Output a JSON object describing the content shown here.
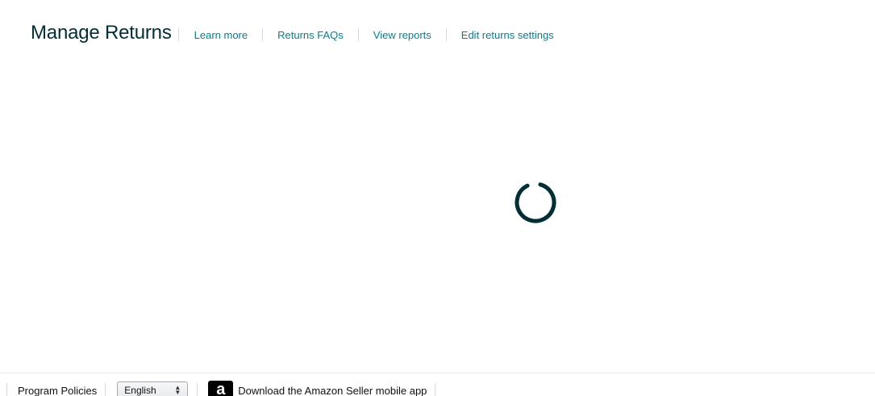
{
  "header": {
    "title": "Manage Returns",
    "links": [
      {
        "label": "Learn more"
      },
      {
        "label": "Returns FAQs"
      },
      {
        "label": "View reports"
      },
      {
        "label": "Edit returns settings"
      }
    ]
  },
  "loading": {
    "icon": "loading-spinner-icon",
    "color": "#002f36"
  },
  "footer": {
    "program_policies": "Program Policies",
    "language_selected": "English",
    "app_icon": "amazon-a-icon",
    "download_app": "Download the Amazon Seller mobile app"
  },
  "colors": {
    "link": "#008296",
    "title": "#002f36"
  }
}
